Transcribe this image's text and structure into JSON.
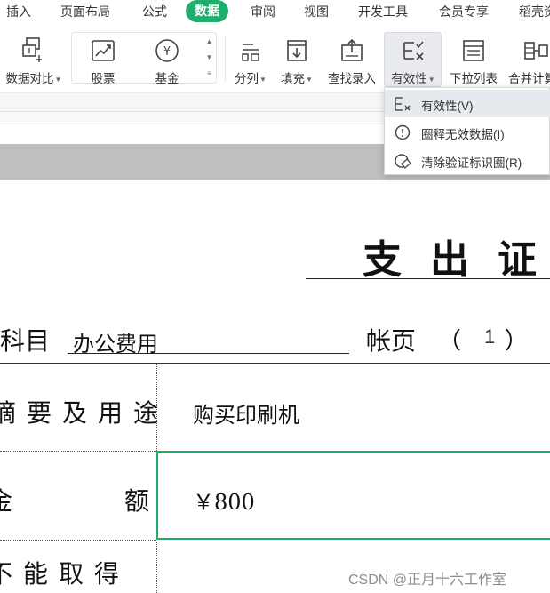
{
  "tabs": [
    "插入",
    "页面布局",
    "公式",
    "数据",
    "审阅",
    "视图",
    "开发工具",
    "会员专享",
    "稻壳资源"
  ],
  "active_tab": "数据",
  "ribbon": {
    "compare": "数据对比",
    "stocks": "股票",
    "funds": "基金",
    "split": "分列",
    "fill": "填充",
    "lookup": "查找录入",
    "validity": "有效性",
    "dropdown_list": "下拉列表",
    "merge_calc": "合并计算"
  },
  "validity_menu": {
    "items": [
      {
        "label": "有效性(V)",
        "icon": "validity-icon"
      },
      {
        "label": "圈释无效数据(I)",
        "icon": "circle-invalid-icon"
      },
      {
        "label": "清除验证标识圈(R)",
        "icon": "clear-circle-icon"
      }
    ]
  },
  "document": {
    "title": "支出证",
    "subject_label": "科目",
    "subject_value": "办公费用",
    "page_label": "帐页",
    "page_open": "（",
    "page_number": "1",
    "page_close": "）",
    "rows": [
      {
        "label": "摘要及用途",
        "value": "购买印刷机"
      },
      {
        "label": "金额",
        "label_left": "金",
        "label_right": "额",
        "value": "￥800"
      },
      {
        "label": "不能取得"
      }
    ]
  },
  "watermark": "CSDN @正月十六工作室",
  "colors": {
    "accent": "#1fae6e",
    "header_gray": "#bfbfbf"
  }
}
